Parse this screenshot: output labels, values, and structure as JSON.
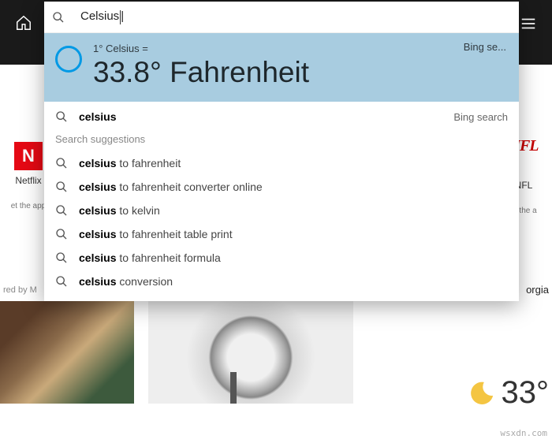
{
  "toolbar": {
    "home_icon": "home-icon",
    "menu_icon": "hamburger-icon"
  },
  "search": {
    "query": "Celsius",
    "answer": {
      "small": "1° Celsius =",
      "big": "33.8° Fahrenheit",
      "source": "Bing se..."
    },
    "top_suggestion": {
      "bold": "celsius",
      "rest": "",
      "provider": "Bing search"
    },
    "suggestions_header": "Search suggestions",
    "suggestions": [
      {
        "bold": "celsius",
        "rest": " to fahrenheit"
      },
      {
        "bold": "celsius",
        "rest": " to fahrenheit converter online"
      },
      {
        "bold": "celsius",
        "rest": " to kelvin"
      },
      {
        "bold": "celsius",
        "rest": " to fahrenheit table print"
      },
      {
        "bold": "celsius",
        "rest": " to fahrenheit formula"
      },
      {
        "bold": "celsius",
        "rest": " conversion"
      }
    ]
  },
  "tiles": {
    "left": {
      "label": "Netflix",
      "sub": "et the app",
      "logo": "N"
    },
    "right": {
      "label": "NFL",
      "sub": "et the a",
      "logo": "NFL"
    }
  },
  "powered": "red by M",
  "georgia": "orgia",
  "weather": {
    "temp": "33°"
  },
  "watermark": "wsxdn.com"
}
